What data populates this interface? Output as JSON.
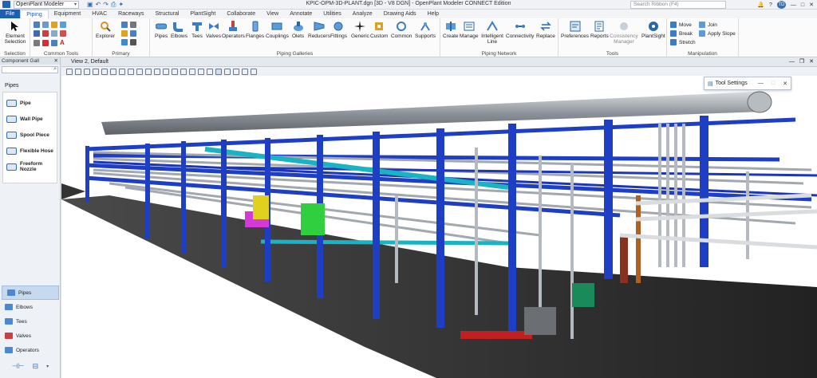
{
  "titlebar": {
    "workspace": "OpenPlant Modeler",
    "title": "KPIC-OPM-3D-PLANT.dgn [3D - V8 DGN] - OpenPlant Modeler CONNECT Edition",
    "search_placeholder": "Search Ribbon (F4)",
    "user_initials": "TD"
  },
  "tabs": [
    "File",
    "Piping",
    "Equipment",
    "HVAC",
    "Raceways",
    "Structural",
    "PlantSight",
    "Collaborate",
    "View",
    "Annotate",
    "Utilities",
    "Analyze",
    "Drawing Aids",
    "Help"
  ],
  "ribbon": {
    "selection": {
      "label": "Selection",
      "element_selection": "Element Selection"
    },
    "common_tools": {
      "label": "Common Tools"
    },
    "primary": {
      "label": "Primary",
      "explorer": "Explorer"
    },
    "piping_galleries": {
      "label": "Piping Galleries",
      "items": [
        "Pipes",
        "Elbows",
        "Tees",
        "Valves",
        "Operators",
        "Flanges",
        "Couplings",
        "Olets",
        "Reducers",
        "Fittings",
        "Generic",
        "Custom",
        "Common",
        "Supports"
      ]
    },
    "piping_network": {
      "label": "Piping Network",
      "items": [
        "Create",
        "Manage",
        "Intelligent Line",
        "Connectivity",
        "Replace"
      ]
    },
    "tools": {
      "label": "Tools",
      "items": [
        "Preferences",
        "Reports",
        "Consistency Manager",
        "PlantSight"
      ]
    },
    "manipulation": {
      "label": "Manipulation",
      "items": [
        "Move",
        "Join",
        "Break",
        "Apply Slope",
        "Stretch"
      ]
    }
  },
  "left_panel": {
    "header": "Component Gall",
    "section_title": "Pipes",
    "items": [
      "Pipe",
      "Wall Pipe",
      "Spool Piece",
      "Flexible Hose",
      "Freeform Nozzle"
    ],
    "nav": [
      "Pipes",
      "Elbows",
      "Tees",
      "Valves",
      "Operators"
    ]
  },
  "view": {
    "title": "View 2, Default"
  },
  "tool_settings": {
    "title": "Tool Settings"
  },
  "colors": {
    "steel_blue": "#1e3fc4",
    "pipe_gray": "#9aa1a8",
    "floor": "#2b2b2b",
    "ribbon_accent": "#1f5fb0"
  }
}
